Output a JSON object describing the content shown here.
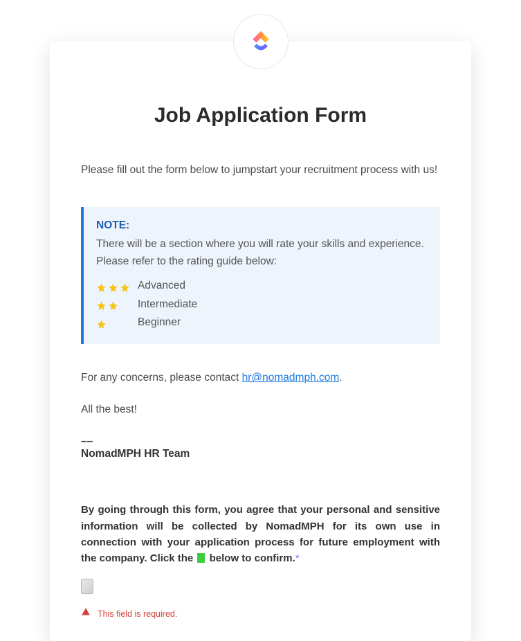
{
  "title": "Job Application Form",
  "intro": "Please fill out the form below to jumpstart your recruitment process with us!",
  "note": {
    "label": "NOTE:",
    "text": "There will be a section where you will rate your skills and experience. Please refer to the rating guide below:",
    "ratings": [
      {
        "stars": 3,
        "label": "Advanced"
      },
      {
        "stars": 2,
        "label": "Intermediate"
      },
      {
        "stars": 1,
        "label": "Beginner"
      }
    ]
  },
  "contact": {
    "prefix": "For any concerns, please contact ",
    "email": "hr@nomadmph.com",
    "suffix": "."
  },
  "signoff": "All the best!",
  "divider": "––",
  "team": "NomadMPH HR Team",
  "consent": {
    "part1": "By going through this form, you agree that your personal and sensitive information will be collected by NomadMPH for its own use in connection with your application process for future employment with the company. Click the ",
    "part2": " below to confirm.",
    "asterisk": "*"
  },
  "error": "This field is required."
}
